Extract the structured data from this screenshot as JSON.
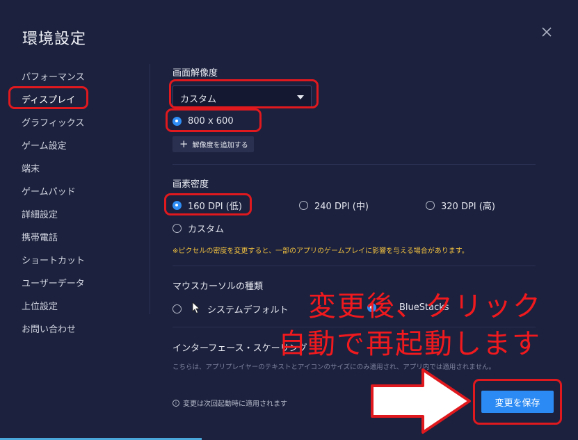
{
  "dialog": {
    "title": "環境設定"
  },
  "sidebar": {
    "items": [
      {
        "label": "パフォーマンス"
      },
      {
        "label": "ディスプレイ"
      },
      {
        "label": "グラフィックス"
      },
      {
        "label": "ゲーム設定"
      },
      {
        "label": "端末"
      },
      {
        "label": "ゲームパッド"
      },
      {
        "label": "詳細設定"
      },
      {
        "label": "携帯電話"
      },
      {
        "label": "ショートカット"
      },
      {
        "label": "ユーザーデータ"
      },
      {
        "label": "上位設定"
      },
      {
        "label": "お問い合わせ"
      }
    ],
    "active_index": 1
  },
  "resolution": {
    "title": "画面解像度",
    "select_value": "カスタム",
    "option_label": "800 x 600",
    "add_button_label": "解像度を追加する"
  },
  "density": {
    "title": "画素密度",
    "options": [
      {
        "label": "160 DPI (低)",
        "checked": true
      },
      {
        "label": "240 DPI (中)",
        "checked": false
      },
      {
        "label": "320 DPI (高)",
        "checked": false
      },
      {
        "label": "カスタム",
        "checked": false
      }
    ],
    "warning": "※ピクセルの密度を変更すると、一部のアプリのゲームプレイに影響を与える場合があります。"
  },
  "cursor": {
    "title": "マウスカーソルの種類",
    "options": [
      {
        "label": "システムデフォルト",
        "checked": false
      },
      {
        "label": "BlueStacks",
        "checked": true
      }
    ]
  },
  "interface_scaling": {
    "title": "インターフェース・スケーリング",
    "description": "こちらは、アプリプレイヤーのテキストとアイコンのサイズにのみ適用され、アプリ内では適用されません。"
  },
  "footer": {
    "info_note": "変更は次回起動時に適用されます",
    "save_label": "変更を保存"
  },
  "annotation": {
    "line1": "変更後、クリック",
    "line2": "自動で再起動します",
    "color": "#f01a1e"
  },
  "colors": {
    "background": "#1c213d",
    "accent": "#2b8af3",
    "warning": "#f0c040",
    "highlight_red": "#e0191e"
  }
}
